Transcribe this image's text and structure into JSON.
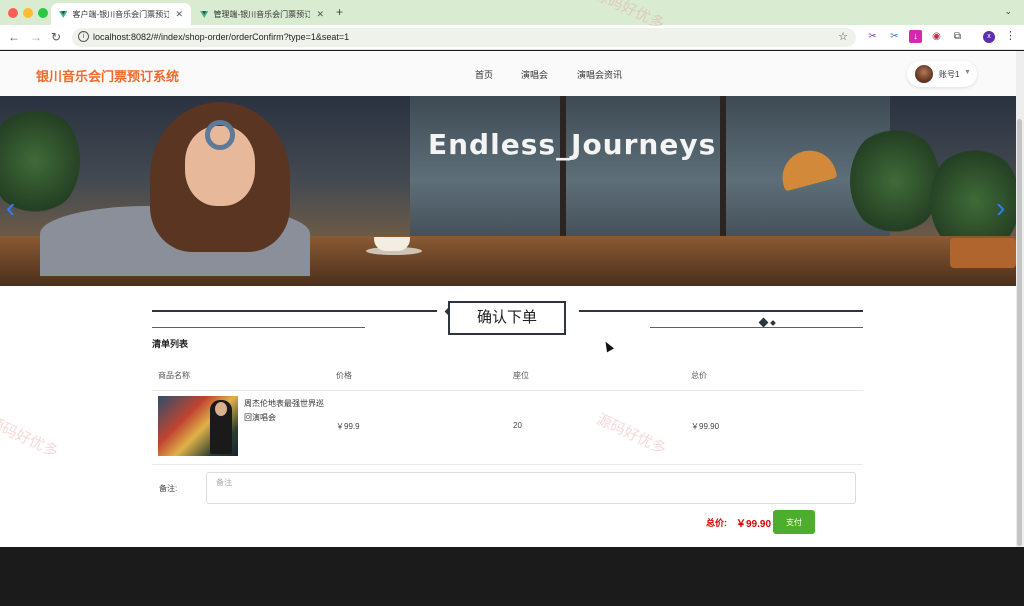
{
  "browser": {
    "tabs": [
      {
        "title": "客户端-银川音乐会门票预订系统",
        "active": true
      },
      {
        "title": "管理端-银川音乐会门票预订系统",
        "active": false
      }
    ],
    "url": "localhost:8082/#/index/shop-order/orderConfirm?type=1&seat=1",
    "profile_initial": "x"
  },
  "header": {
    "brand": "银川音乐会门票预订系统",
    "nav": [
      "首页",
      "演唱会",
      "演唱会资讯"
    ],
    "account": "账号1",
    "brand_color": "#f06a2d"
  },
  "banner": {
    "title": "Endless_Journeys"
  },
  "order": {
    "heading": "确认下单",
    "list_title": "清单列表",
    "columns": [
      "商品名称",
      "价格",
      "座位",
      "总价"
    ],
    "items": [
      {
        "name": "周杰伦地表最强世界巡回演唱会",
        "price": "￥99.9",
        "seat": "20",
        "total": "￥99.90"
      }
    ],
    "remark_label": "备注:",
    "remark_placeholder": "备注",
    "total_label": "总价:",
    "total_value": "￥99.90",
    "pay_label": "支付",
    "pay_color": "#4cae2c"
  },
  "watermark": "源码好优多"
}
